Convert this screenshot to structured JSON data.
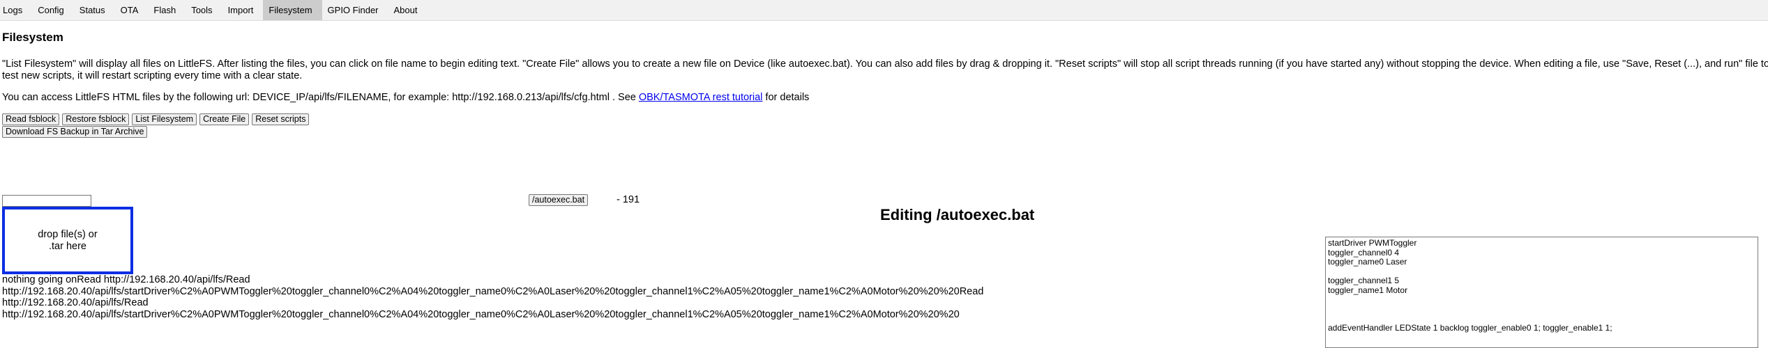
{
  "nav": {
    "tabs": [
      "Logs",
      "Config",
      "Status",
      "OTA",
      "Flash",
      "Tools",
      "Import",
      "Filesystem",
      "GPIO Finder",
      "About"
    ],
    "active": "Filesystem"
  },
  "page": {
    "title": "Filesystem",
    "desc1": "\"List Filesystem\" will display all files on LittleFS. After listing the files, you can click on file name to begin editing text. \"Create File\" allows you to create a new file on Device (like autoexec.bat). You can also add files by drag & dropping it. \"Reset scripts\" will stop all script threads running (if you have started any) without stopping the device. When editing a file, use \"Save, Reset (...), and run\" file to",
    "desc2": "test new scripts, it will restart scripting every time with a clear state.",
    "access_prefix": "You can access LittleFS HTML files by the following url: DEVICE_IP/api/lfs/FILENAME, for example: http://192.168.0.213/api/lfs/cfg.html . See ",
    "access_link": "OBK/TASMOTA rest tutorial",
    "access_suffix": " for details"
  },
  "buttons": {
    "read_fsblock": "Read fsblock",
    "restore_fsblock": "Restore fsblock",
    "list_filesystem": "List Filesystem",
    "create_file": "Create File",
    "reset_scripts": "Reset scripts",
    "download_backup": "Download FS Backup in Tar Archive"
  },
  "file_list": {
    "file_name": "/autoexec.bat",
    "file_size_text": "- 191"
  },
  "dropzone": {
    "line1": "drop file(s) or",
    "line2": ".tar here"
  },
  "log_lines": [
    "nothing going onRead http://192.168.20.40/api/lfs/Read",
    "http://192.168.20.40/api/lfs/startDriver%C2%A0PWMToggler%20toggler_channel0%C2%A04%20toggler_name0%C2%A0Laser%20%20toggler_channel1%C2%A05%20toggler_name1%C2%A0Motor%20%20%20Read",
    "http://192.168.20.40/api/lfs/Read",
    "http://192.168.20.40/api/lfs/startDriver%C2%A0PWMToggler%20toggler_channel0%C2%A04%20toggler_name0%C2%A0Laser%20%20toggler_channel1%C2%A05%20toggler_name1%C2%A0Motor%20%20%20"
  ],
  "editor": {
    "heading": "Editing /autoexec.bat",
    "lines": [
      "startDriver PWMToggler",
      "toggler_channel0 4",
      "toggler_name0 Laser",
      "",
      "toggler_channel1 5",
      "toggler_name1 Motor",
      "",
      "",
      "",
      "addEventHandler LEDState 1 backlog toggler_enable0 1; toggler_enable1 1;"
    ]
  }
}
